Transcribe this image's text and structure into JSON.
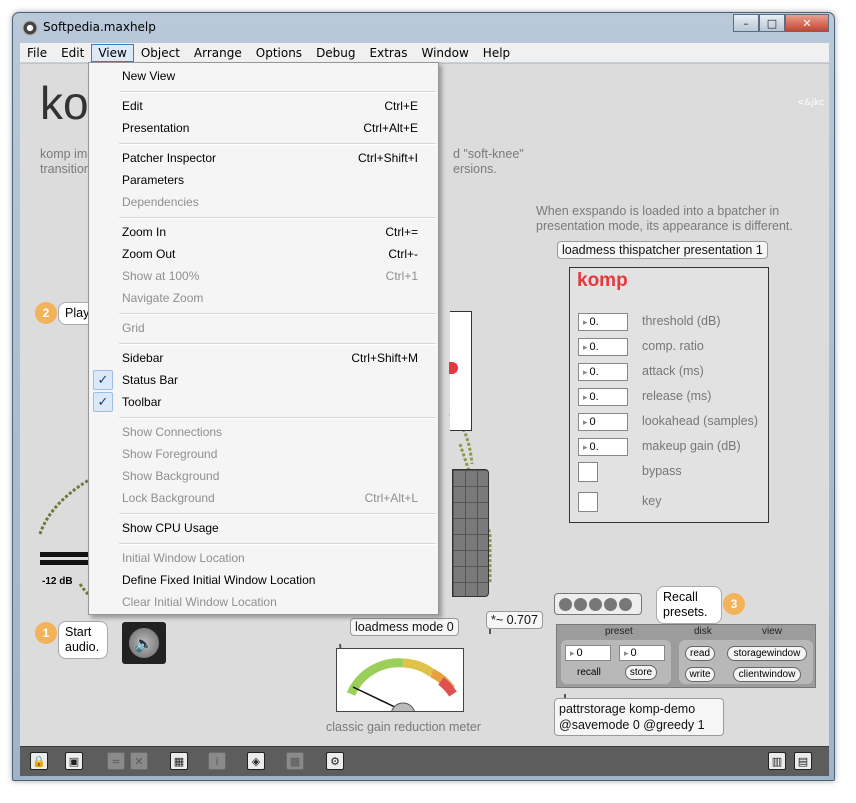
{
  "window": {
    "title": "Softpedia.maxhelp",
    "min": "–",
    "max": "□",
    "close": "✕"
  },
  "menubar": [
    "File",
    "Edit",
    "View",
    "Object",
    "Arrange",
    "Options",
    "Debug",
    "Extras",
    "Window",
    "Help"
  ],
  "canvas": {
    "title": "komp",
    "author": "<&jkc",
    "desc_line1": "komp impl",
    "desc_line1b": "d \"soft-knee\"",
    "desc_line2": "transition",
    "desc_line2b": "ersions.",
    "bpatcher_note": "When exspando is loaded into a bpatcher in presentation mode, its appearance is different.",
    "loadmess_presentation": "loadmess thispatcher presentation 1",
    "play_bubble": "Play s",
    "start_bubble": "Start audio.",
    "meter_db": "-12 dB",
    "loadmess_mode": "loadmess mode 0",
    "gain_obj": "*~ 0.707",
    "meter_caption": "classic gain reduction meter",
    "recall_bubble": "Recall presets.",
    "pattr_obj": "pattrstorage komp-demo @savemode 0 @greedy 1",
    "step1": "1",
    "step2": "2",
    "step3": "3"
  },
  "bpatcher": {
    "title": "komp",
    "params": [
      {
        "value": "0.",
        "label": "threshold (dB)"
      },
      {
        "value": "0.",
        "label": "comp. ratio"
      },
      {
        "value": "0.",
        "label": "attack (ms)"
      },
      {
        "value": "0.",
        "label": "release (ms)"
      },
      {
        "value": "0",
        "label": "lookahead (samples)"
      },
      {
        "value": "0.",
        "label": "makeup gain (dB)"
      }
    ],
    "bypass": "bypass",
    "key": "key"
  },
  "presets": {
    "preset_header": "preset",
    "disk_header": "disk",
    "view_header": "view",
    "num1": "0",
    "num2": "0",
    "recall": "recall",
    "store": "store",
    "read": "read",
    "write": "write",
    "storagewindow": "storagewindow",
    "clientwindow": "clientwindow"
  },
  "view_menu": [
    {
      "label": "New View",
      "shortcut": "",
      "disabled": false
    },
    {
      "label": "Edit",
      "shortcut": "Ctrl+E",
      "disabled": false
    },
    {
      "label": "Presentation",
      "shortcut": "Ctrl+Alt+E",
      "disabled": false
    },
    {
      "label": "Patcher Inspector",
      "shortcut": "Ctrl+Shift+I",
      "disabled": false
    },
    {
      "label": "Parameters",
      "shortcut": "",
      "disabled": false
    },
    {
      "label": "Dependencies",
      "shortcut": "",
      "disabled": true
    },
    {
      "label": "Zoom In",
      "shortcut": "Ctrl+=",
      "disabled": false
    },
    {
      "label": "Zoom Out",
      "shortcut": "Ctrl+-",
      "disabled": false
    },
    {
      "label": "Show at 100%",
      "shortcut": "Ctrl+1",
      "disabled": true
    },
    {
      "label": "Navigate Zoom",
      "shortcut": "",
      "disabled": true
    },
    {
      "label": "Grid",
      "shortcut": "",
      "disabled": true
    },
    {
      "label": "Sidebar",
      "shortcut": "Ctrl+Shift+M",
      "disabled": false
    },
    {
      "label": "Status Bar",
      "shortcut": "",
      "disabled": false,
      "checked": true
    },
    {
      "label": "Toolbar",
      "shortcut": "",
      "disabled": false,
      "checked": true
    },
    {
      "label": "Show Connections",
      "shortcut": "",
      "disabled": true
    },
    {
      "label": "Show Foreground",
      "shortcut": "",
      "disabled": true
    },
    {
      "label": "Show Background",
      "shortcut": "",
      "disabled": true
    },
    {
      "label": "Lock Background",
      "shortcut": "Ctrl+Alt+L",
      "disabled": true
    },
    {
      "label": "Show CPU Usage",
      "shortcut": "",
      "disabled": false
    },
    {
      "label": "Initial Window Location",
      "shortcut": "",
      "disabled": true
    },
    {
      "label": "Define Fixed Initial Window Location",
      "shortcut": "",
      "disabled": false
    },
    {
      "label": "Clear Initial Window Location",
      "shortcut": "",
      "disabled": true
    }
  ],
  "icons": {
    "check": "✓"
  },
  "colors": {
    "komp_red": "#e8373e",
    "step_orange": "#f2b35a",
    "toolbar_bg": "#5d5d5d"
  }
}
